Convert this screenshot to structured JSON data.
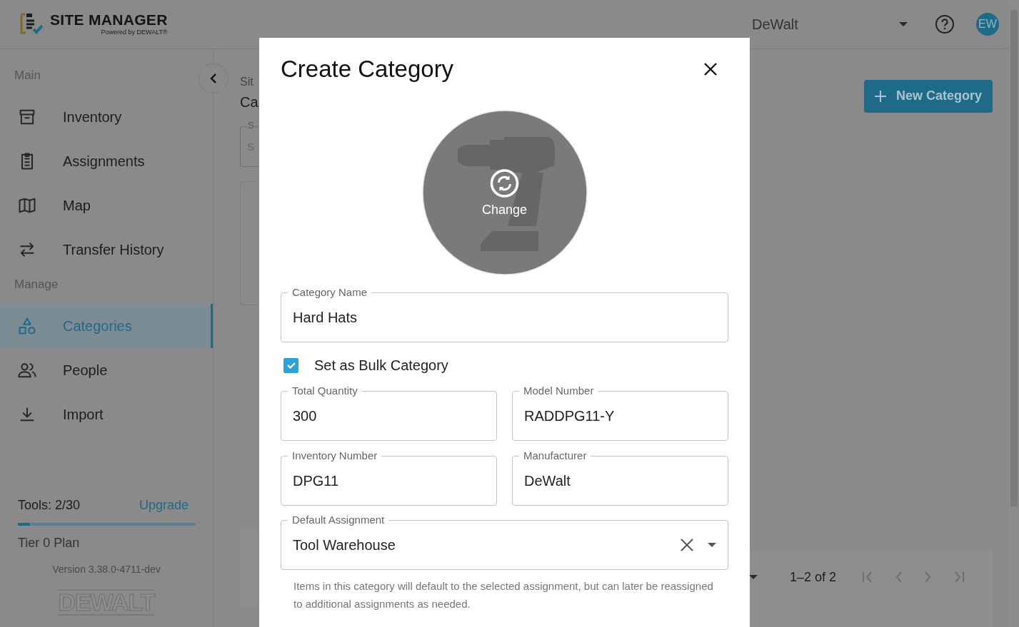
{
  "header": {
    "app_name": "SITE MANAGER",
    "tagline": "Powered by DEWALT®",
    "organization": "DeWalt",
    "avatar": "EW"
  },
  "sidebar": {
    "sections": [
      {
        "title": "Main",
        "items": [
          {
            "label": "Inventory",
            "selected": false
          },
          {
            "label": "Assignments",
            "selected": false
          },
          {
            "label": "Map",
            "selected": false
          },
          {
            "label": "Transfer History",
            "selected": false
          }
        ]
      },
      {
        "title": "Manage",
        "items": [
          {
            "label": "Categories",
            "selected": true
          },
          {
            "label": "People",
            "selected": false
          },
          {
            "label": "Import",
            "selected": false
          }
        ]
      }
    ],
    "usage": {
      "label": "Tools: 2/30",
      "link": "Upgrade",
      "level": 0.07
    },
    "plan": "Tier 0 Plan",
    "version": "Version 3.38.0-4711-dev",
    "brand": "DEWALT"
  },
  "page": {
    "breadcrumb": "Sit",
    "title": "Ca",
    "search": {
      "label": "S",
      "placeholder": "S"
    },
    "new_button": "New Category",
    "pagination": {
      "range": "1–2 of 2"
    }
  },
  "dialog": {
    "title": "Create Category",
    "image_action": "Change",
    "category_name": {
      "label": "Category Name",
      "value": "Hard Hats"
    },
    "bulk": {
      "label": "Set as Bulk Category",
      "checked": true
    },
    "fields": [
      {
        "label": "Total Quantity",
        "value": "300"
      },
      {
        "label": "Model Number",
        "value": "RADDPG11-Y"
      },
      {
        "label": "Inventory Number",
        "value": "DPG11"
      },
      {
        "label": "Manufacturer",
        "value": "DeWalt"
      }
    ],
    "default_assignment": {
      "label": "Default Assignment",
      "value": "Tool Warehouse",
      "helper": "Items in this category will default to the selected assignment, but can later be reassigned to additional assignments as needed."
    }
  }
}
